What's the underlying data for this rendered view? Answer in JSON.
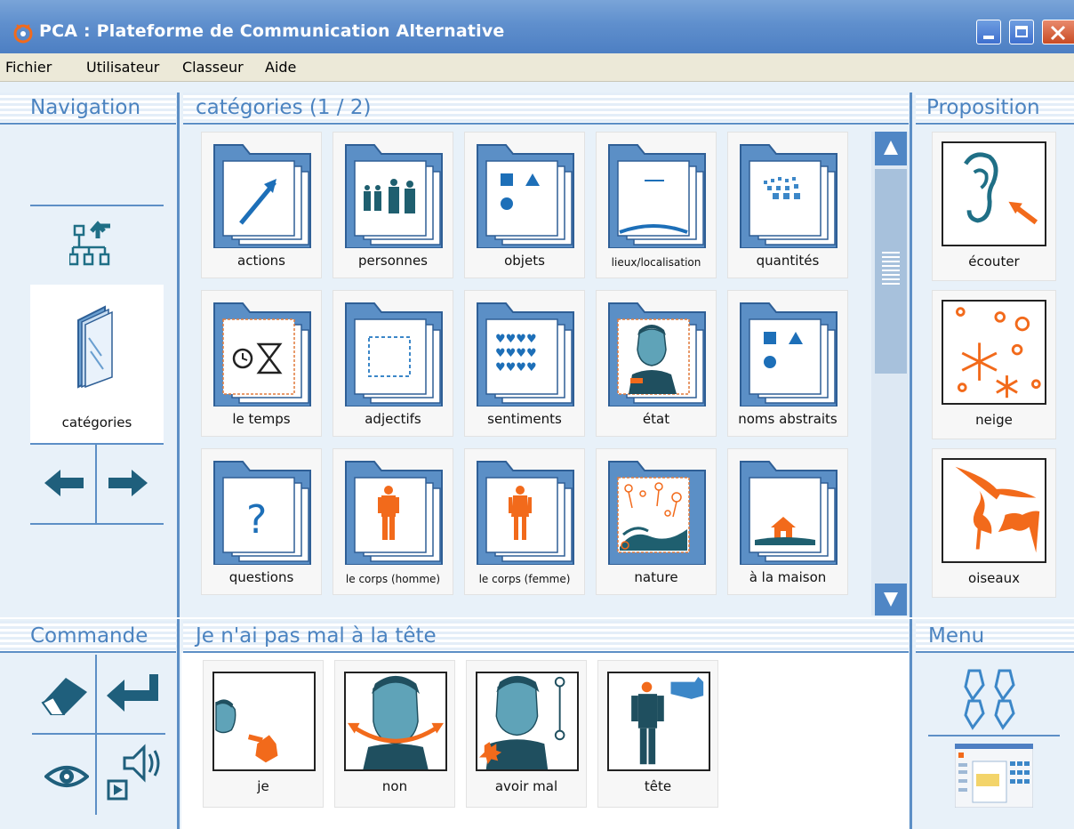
{
  "window": {
    "title": "PCA : Plateforme de Communication Alternative"
  },
  "menu": [
    "Fichier",
    "Utilisateur",
    "Classeur",
    "Aide"
  ],
  "panels": {
    "navigation": "Navigation",
    "categories": "catégories (1 / 2)",
    "proposition": "Proposition",
    "commande": "Commande",
    "sentence": "Je n'ai pas mal à la tête",
    "menu": "Menu"
  },
  "navigation": {
    "current_label": "catégories",
    "icons": [
      "hierarchy-up-icon",
      "book-icon",
      "arrow-left-icon",
      "arrow-right-icon"
    ]
  },
  "categories": [
    {
      "label": "actions",
      "icon": "arrow-icon"
    },
    {
      "label": "personnes",
      "icon": "people-icon"
    },
    {
      "label": "objets",
      "icon": "shapes-icon"
    },
    {
      "label": "lieux/localisation",
      "icon": "place-icon"
    },
    {
      "label": "quantités",
      "icon": "quantity-icon"
    },
    {
      "label": "le temps",
      "icon": "time-icon"
    },
    {
      "label": "adjectifs",
      "icon": "dashed-square-icon"
    },
    {
      "label": "sentiments",
      "icon": "hearts-icon"
    },
    {
      "label": "état",
      "icon": "face-icon"
    },
    {
      "label": "noms abstraits",
      "icon": "shapes-icon"
    },
    {
      "label": "questions",
      "icon": "question-mark-icon"
    },
    {
      "label": "le corps (homme)",
      "icon": "man-body-icon"
    },
    {
      "label": "le corps (femme)",
      "icon": "woman-body-icon"
    },
    {
      "label": "nature",
      "icon": "nature-icon"
    },
    {
      "label": "à la maison",
      "icon": "house-icon"
    }
  ],
  "propositions": [
    {
      "label": "écouter",
      "icon": "ear-icon"
    },
    {
      "label": "neige",
      "icon": "snowflake-icon"
    },
    {
      "label": "oiseaux",
      "icon": "birds-icon"
    }
  ],
  "sentence_words": [
    {
      "label": "je",
      "icon": "me-icon"
    },
    {
      "label": "non",
      "icon": "head-shake-icon"
    },
    {
      "label": "avoir mal",
      "icon": "pain-icon"
    },
    {
      "label": "tête",
      "icon": "head-point-icon"
    }
  ],
  "commands": [
    "eraser-icon",
    "enter-icon",
    "eye-icon",
    "speaker-icon"
  ],
  "menu_icons": [
    "chain-icon",
    "screenshot-thumbnail-icon"
  ],
  "colors": {
    "accent": "#4b83c0",
    "folder": "#5b8fc6",
    "orange": "#f26a1b",
    "teal": "#1f6f86"
  }
}
